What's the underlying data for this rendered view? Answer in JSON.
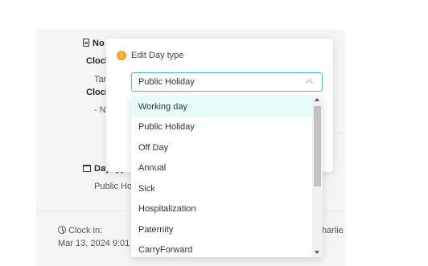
{
  "background": {
    "notes_header": "No",
    "clock_label_1": "Clock",
    "tar_text": "Tar",
    "clock_label_2": "Clock",
    "dash_text": "- N",
    "day_type_label": "Day type",
    "day_type_value": "Public Ho",
    "clock_in_label": "Clock in:",
    "clock_in_value": "Mar 13, 2024 9:01",
    "employee_name": "Charlie"
  },
  "modal": {
    "title": "Edit Day type",
    "warning_icon": "!",
    "selected_value": "Public Holiday",
    "options": [
      "Working day",
      "Public Holiday",
      "Off Day",
      "Annual",
      "Sick",
      "Hospitalization",
      "Paternity",
      "CarryForward"
    ]
  },
  "colors": {
    "accent": "#4fc3c7",
    "warning": "#f5a623",
    "option_hover": "#e8fbfb"
  }
}
